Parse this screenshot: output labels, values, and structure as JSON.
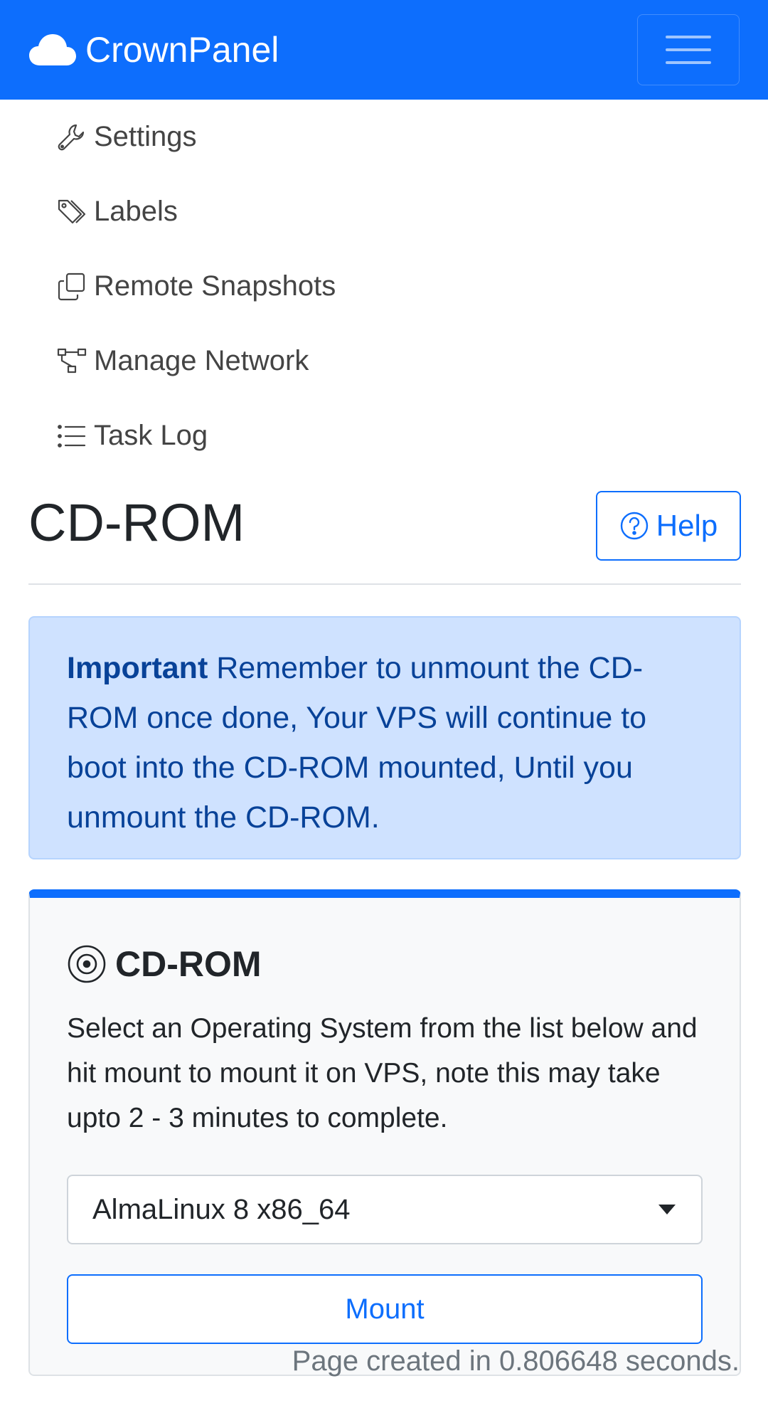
{
  "navbar": {
    "brand": "CrownPanel",
    "logo_icon": "cloud-icon",
    "menu_icon": "hamburger-icon"
  },
  "nav": {
    "items": [
      {
        "label": "Settings",
        "icon": "wrench-icon"
      },
      {
        "label": "Labels",
        "icon": "tags-icon"
      },
      {
        "label": "Remote Snapshots",
        "icon": "copy-icon"
      },
      {
        "label": "Manage Network",
        "icon": "network-icon"
      },
      {
        "label": "Task Log",
        "icon": "list-icon"
      }
    ]
  },
  "header": {
    "title": "CD-ROM",
    "help_label": "Help",
    "help_icon": "question-circle-icon"
  },
  "alert": {
    "strong": "Important",
    "text": " Remember to unmount the CD-ROM once done, Your VPS will continue to boot into the CD-ROM mounted, Until you unmount the CD-ROM."
  },
  "card": {
    "title": "CD-ROM",
    "title_icon": "disc-icon",
    "description": "Select an Operating System from the list below and hit mount to mount it on VPS, note this may take upto 2 - 3 minutes to complete.",
    "select_value": "AlmaLinux 8 x86_64",
    "mount_label": "Mount"
  },
  "footer": {
    "text": "Page created in 0.806648 seconds."
  },
  "colors": {
    "primary": "#0d6efd",
    "alert_bg": "#cfe2ff",
    "alert_text": "#084298"
  }
}
